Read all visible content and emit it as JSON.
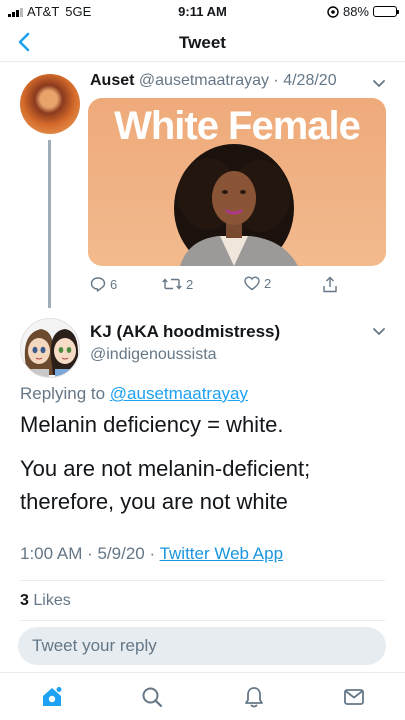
{
  "status_bar": {
    "carrier": "AT&T",
    "network": "5GE",
    "time": "9:11 AM",
    "battery": "88%",
    "battery_level": 0.88
  },
  "header": {
    "title": "Tweet",
    "back_icon": "chevron-left-icon"
  },
  "parent_tweet": {
    "name": "Auset",
    "handle": "@ausetmaatrayay",
    "date": "4/28/20",
    "media_text": "White Female",
    "actions": {
      "replies": "6",
      "retweets": "2",
      "likes": "2"
    }
  },
  "main_tweet": {
    "name": "KJ (AKA hoodmistress)",
    "handle": "@indigenoussista",
    "replying_prefix": "Replying to",
    "replying_to": "@ausetmaatrayay",
    "text_line1": "Melanin deficiency = white.",
    "text_line2a": "You are not melanin-deficient;",
    "text_line2b": "therefore, you are not white",
    "timestamp": "1:00 AM · 5/9/20 ·",
    "client": "Twitter Web App",
    "likes_count": "3",
    "likes_label": "Likes"
  },
  "reply_box": {
    "placeholder": "Tweet your reply"
  },
  "tabbar": {
    "items": [
      "home-icon",
      "search-icon",
      "notifications-icon",
      "messages-icon"
    ]
  },
  "colors": {
    "accent": "#1da1f2",
    "muted": "#657786",
    "text": "#14171a",
    "divider": "#e6ecf0"
  }
}
